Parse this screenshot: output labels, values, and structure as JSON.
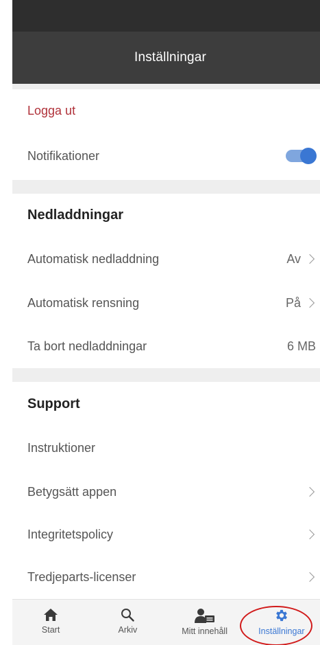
{
  "header": {
    "title": "Inställningar"
  },
  "account": {
    "logout_label": "Logga ut",
    "notifications_label": "Notifikationer",
    "notifications_enabled": true
  },
  "downloads": {
    "section_title": "Nedladdningar",
    "auto_download_label": "Automatisk nedladdning",
    "auto_download_value": "Av",
    "auto_clean_label": "Automatisk rensning",
    "auto_clean_value": "På",
    "remove_label": "Ta bort nedladdningar",
    "remove_value": "6 MB"
  },
  "support": {
    "section_title": "Support",
    "instructions_label": "Instruktioner",
    "rate_label": "Betygsätt appen",
    "privacy_label": "Integritetspolicy",
    "licenses_label": "Tredjeparts-licenser"
  },
  "tabbar": {
    "items": [
      {
        "label": "Start",
        "icon": "home-icon"
      },
      {
        "label": "Arkiv",
        "icon": "search-icon"
      },
      {
        "label": "Mitt innehåll",
        "icon": "user-card-icon"
      },
      {
        "label": "Inställningar",
        "icon": "gear-icon",
        "active": true
      }
    ]
  },
  "colors": {
    "app_bar": "#3d3d3d",
    "accent": "#3a77d3",
    "logout": "#b0323a",
    "size_value": "#1b6f8a",
    "highlight": "#d11a1a"
  }
}
